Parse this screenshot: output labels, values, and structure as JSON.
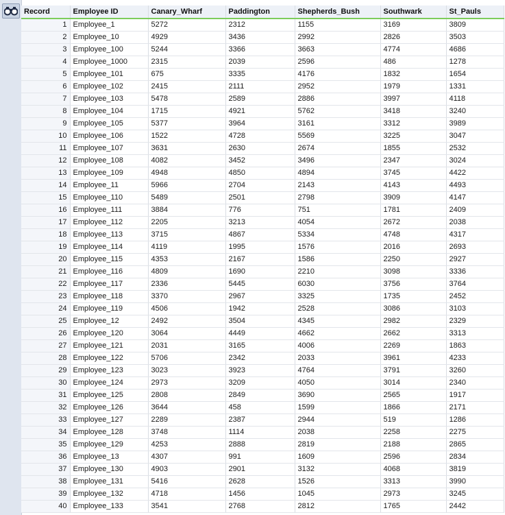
{
  "toolbar": {
    "binoculars_icon": "binoculars-icon"
  },
  "table": {
    "columns": [
      "Record",
      "Employee ID",
      "Canary_Wharf",
      "Paddington",
      "Shepherds_Bush",
      "Southwark",
      "St_Pauls"
    ],
    "rows": [
      [
        "1",
        "Employee_1",
        "5272",
        "2312",
        "1155",
        "3169",
        "3809"
      ],
      [
        "2",
        "Employee_10",
        "4929",
        "3436",
        "2992",
        "2826",
        "3503"
      ],
      [
        "3",
        "Employee_100",
        "5244",
        "3366",
        "3663",
        "4774",
        "4686"
      ],
      [
        "4",
        "Employee_1000",
        "2315",
        "2039",
        "2596",
        "486",
        "1278"
      ],
      [
        "5",
        "Employee_101",
        "675",
        "3335",
        "4176",
        "1832",
        "1654"
      ],
      [
        "6",
        "Employee_102",
        "2415",
        "2111",
        "2952",
        "1979",
        "1331"
      ],
      [
        "7",
        "Employee_103",
        "5478",
        "2589",
        "2886",
        "3997",
        "4118"
      ],
      [
        "8",
        "Employee_104",
        "1715",
        "4921",
        "5762",
        "3418",
        "3240"
      ],
      [
        "9",
        "Employee_105",
        "5377",
        "3964",
        "3161",
        "3312",
        "3989"
      ],
      [
        "10",
        "Employee_106",
        "1522",
        "4728",
        "5569",
        "3225",
        "3047"
      ],
      [
        "11",
        "Employee_107",
        "3631",
        "2630",
        "2674",
        "1855",
        "2532"
      ],
      [
        "12",
        "Employee_108",
        "4082",
        "3452",
        "3496",
        "2347",
        "3024"
      ],
      [
        "13",
        "Employee_109",
        "4948",
        "4850",
        "4894",
        "3745",
        "4422"
      ],
      [
        "14",
        "Employee_11",
        "5966",
        "2704",
        "2143",
        "4143",
        "4493"
      ],
      [
        "15",
        "Employee_110",
        "5489",
        "2501",
        "2798",
        "3909",
        "4147"
      ],
      [
        "16",
        "Employee_111",
        "3884",
        "776",
        "751",
        "1781",
        "2409"
      ],
      [
        "17",
        "Employee_112",
        "2205",
        "3213",
        "4054",
        "2672",
        "2038"
      ],
      [
        "18",
        "Employee_113",
        "3715",
        "4867",
        "5334",
        "4748",
        "4317"
      ],
      [
        "19",
        "Employee_114",
        "4119",
        "1995",
        "1576",
        "2016",
        "2693"
      ],
      [
        "20",
        "Employee_115",
        "4353",
        "2167",
        "1586",
        "2250",
        "2927"
      ],
      [
        "21",
        "Employee_116",
        "4809",
        "1690",
        "2210",
        "3098",
        "3336"
      ],
      [
        "22",
        "Employee_117",
        "2336",
        "5445",
        "6030",
        "3756",
        "3764"
      ],
      [
        "23",
        "Employee_118",
        "3370",
        "2967",
        "3325",
        "1735",
        "2452"
      ],
      [
        "24",
        "Employee_119",
        "4506",
        "1942",
        "2528",
        "3086",
        "3103"
      ],
      [
        "25",
        "Employee_12",
        "2492",
        "3504",
        "4345",
        "2982",
        "2329"
      ],
      [
        "26",
        "Employee_120",
        "3064",
        "4449",
        "4662",
        "2662",
        "3313"
      ],
      [
        "27",
        "Employee_121",
        "2031",
        "3165",
        "4006",
        "2269",
        "1863"
      ],
      [
        "28",
        "Employee_122",
        "5706",
        "2342",
        "2033",
        "3961",
        "4233"
      ],
      [
        "29",
        "Employee_123",
        "3023",
        "3923",
        "4764",
        "3791",
        "3260"
      ],
      [
        "30",
        "Employee_124",
        "2973",
        "3209",
        "4050",
        "3014",
        "2340"
      ],
      [
        "31",
        "Employee_125",
        "2808",
        "2849",
        "3690",
        "2565",
        "1917"
      ],
      [
        "32",
        "Employee_126",
        "3644",
        "458",
        "1599",
        "1866",
        "2171"
      ],
      [
        "33",
        "Employee_127",
        "2289",
        "2387",
        "2944",
        "519",
        "1286"
      ],
      [
        "34",
        "Employee_128",
        "3748",
        "1114",
        "2038",
        "2258",
        "2275"
      ],
      [
        "35",
        "Employee_129",
        "4253",
        "2888",
        "2819",
        "2188",
        "2865"
      ],
      [
        "36",
        "Employee_13",
        "4307",
        "991",
        "1609",
        "2596",
        "2834"
      ],
      [
        "37",
        "Employee_130",
        "4903",
        "2901",
        "3132",
        "4068",
        "3819"
      ],
      [
        "38",
        "Employee_131",
        "5416",
        "2628",
        "1526",
        "3313",
        "3990"
      ],
      [
        "39",
        "Employee_132",
        "4718",
        "1456",
        "1045",
        "2973",
        "3245"
      ],
      [
        "40",
        "Employee_133",
        "3541",
        "2768",
        "2812",
        "1765",
        "2442"
      ]
    ]
  }
}
